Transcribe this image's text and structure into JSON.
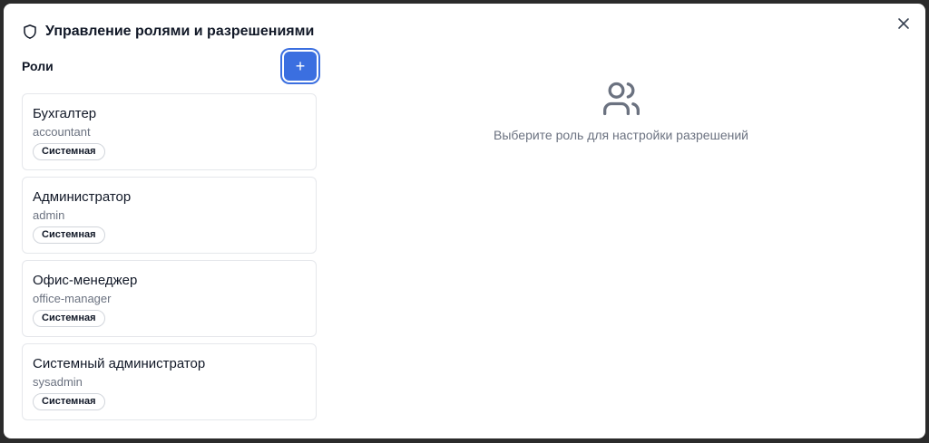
{
  "dialog": {
    "title": "Управление ролями и разрешениями",
    "title_icon": "shield-icon",
    "close_icon": "close-icon"
  },
  "sidebar": {
    "heading": "Роли",
    "add_button_label": "+",
    "roles": [
      {
        "title": "Бухгалтер",
        "slug": "accountant",
        "badge": "Системная"
      },
      {
        "title": "Администратор",
        "slug": "admin",
        "badge": "Системная"
      },
      {
        "title": "Офис-менеджер",
        "slug": "office-manager",
        "badge": "Системная"
      },
      {
        "title": "Системный администратор",
        "slug": "sysadmin",
        "badge": "Системная"
      }
    ]
  },
  "main": {
    "empty_icon": "users-icon",
    "empty_text": "Выберите роль для настройки разрешений"
  },
  "colors": {
    "accent": "#3b6fe0",
    "muted_text": "#6b7280",
    "border": "#e5e7eb"
  }
}
